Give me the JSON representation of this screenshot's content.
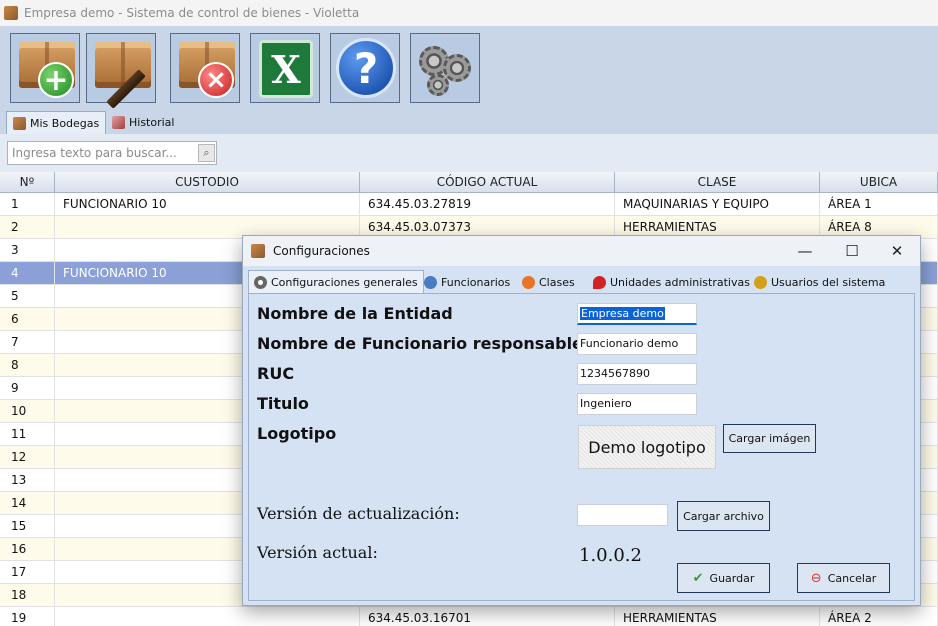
{
  "window": {
    "title": "Empresa demo - Sistema de control de bienes - Violetta"
  },
  "toolbar": {
    "add_label": "+",
    "delete_label": "×",
    "excel_label": "X",
    "help_label": "?"
  },
  "tabs": [
    {
      "label": "Mis Bodegas"
    },
    {
      "label": "Historial"
    }
  ],
  "search": {
    "placeholder": "Ingresa texto para buscar..."
  },
  "table": {
    "columns": [
      "Nº",
      "CUSTODIO",
      "CÓDIGO ACTUAL",
      "CLASE",
      "UBICA"
    ],
    "rows": [
      [
        "1",
        "FUNCIONARIO 10",
        "634.45.03.27819",
        "MAQUINARIAS Y EQUIPO",
        "ÁREA 1"
      ],
      [
        "2",
        "",
        "634.45.03.07373",
        "HERRAMIENTAS",
        "ÁREA 8"
      ],
      [
        "3",
        "",
        "",
        "",
        ""
      ],
      [
        "4",
        "FUNCIONARIO 10",
        "",
        "",
        ""
      ],
      [
        "5",
        "",
        "",
        "",
        ""
      ],
      [
        "6",
        "",
        "",
        "",
        ""
      ],
      [
        "7",
        "",
        "",
        "",
        ""
      ],
      [
        "8",
        "",
        "",
        "",
        ""
      ],
      [
        "9",
        "",
        "",
        "",
        ""
      ],
      [
        "10",
        "",
        "",
        "",
        ""
      ],
      [
        "11",
        "",
        "",
        "",
        ""
      ],
      [
        "12",
        "",
        "",
        "",
        ""
      ],
      [
        "13",
        "",
        "",
        "",
        ""
      ],
      [
        "14",
        "",
        "",
        "",
        ""
      ],
      [
        "15",
        "",
        "",
        "",
        ""
      ],
      [
        "16",
        "",
        "",
        "",
        ""
      ],
      [
        "17",
        "",
        "",
        "",
        ""
      ],
      [
        "18",
        "",
        "",
        "",
        ""
      ],
      [
        "19",
        "",
        "634.45.03.16701",
        "HERRAMIENTAS",
        "ÁREA 2"
      ]
    ],
    "selected_row": 3
  },
  "dialog": {
    "title": "Configuraciones",
    "minimize": "—",
    "maximize": "☐",
    "close": "✕",
    "tabs": [
      {
        "label": "Configuraciones generales"
      },
      {
        "label": "Funcionarios"
      },
      {
        "label": "Clases"
      },
      {
        "label": "Unidades administrativas"
      },
      {
        "label": "Usuarios del sistema"
      }
    ],
    "fields": {
      "entity_label": "Nombre de la Entidad",
      "entity_value": "Empresa demo",
      "responsible_label": "Nombre de Funcionario responsable",
      "responsible_value": "Funcionario demo",
      "ruc_label": "RUC",
      "ruc_value": "1234567890",
      "title_label": "Titulo",
      "title_value": "Ingeniero",
      "logo_label": "Logotipo",
      "logo_text": "Demo logotipo",
      "load_image": "Cargar imágen",
      "update_label": "Versión de actualización:",
      "update_value": "",
      "load_file": "Cargar archivo",
      "current_label": "Versión actual:",
      "current_value": "1.0.0.2"
    },
    "buttons": {
      "save": "Guardar",
      "cancel": "Cancelar"
    }
  }
}
